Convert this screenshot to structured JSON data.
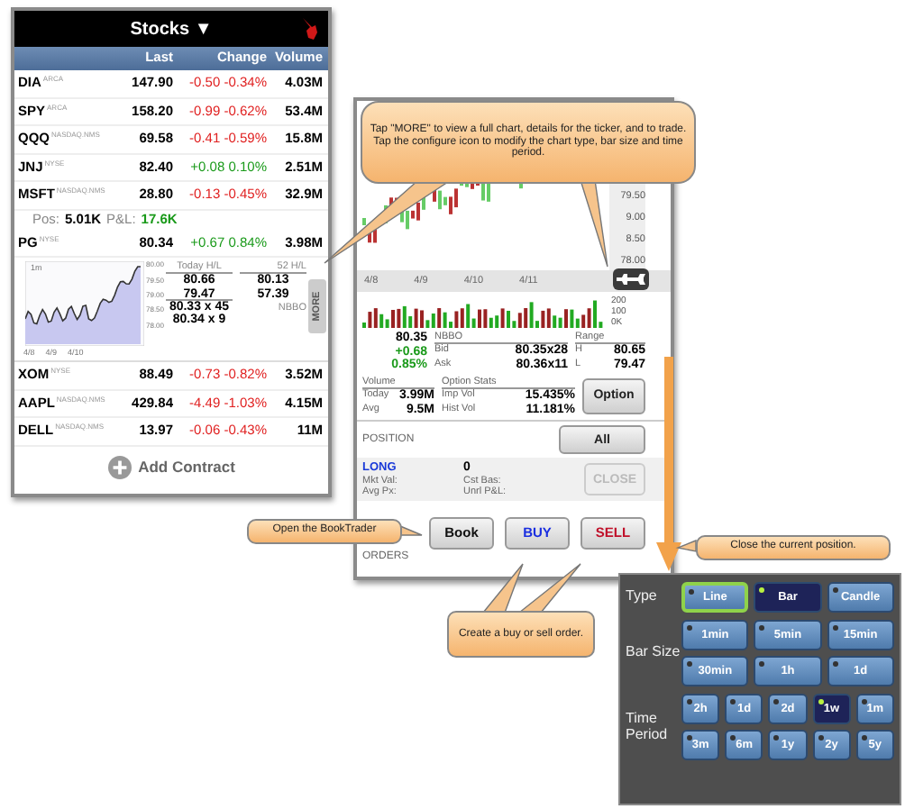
{
  "watchlist": {
    "title": "Stocks",
    "dropdown": "▼",
    "columns": [
      "Last",
      "Change",
      "Volume"
    ],
    "rows": [
      {
        "symbol": "DIA",
        "exchange": "ARCA",
        "last": "147.90",
        "change": "-0.50",
        "change_pct": "-0.34%",
        "volume": "4.03M",
        "negative": true
      },
      {
        "symbol": "SPY",
        "exchange": "ARCA",
        "last": "158.20",
        "change": "-0.99",
        "change_pct": "-0.62%",
        "volume": "53.4M",
        "negative": true
      },
      {
        "symbol": "QQQ",
        "exchange": "NASDAQ.NMS",
        "last": "69.58",
        "change": "-0.41",
        "change_pct": "-0.59%",
        "volume": "15.8M",
        "negative": true
      },
      {
        "symbol": "JNJ",
        "exchange": "NYSE",
        "last": "82.40",
        "change": "+0.08",
        "change_pct": "0.10%",
        "volume": "2.51M",
        "negative": false
      },
      {
        "symbol": "MSFT",
        "exchange": "NASDAQ.NMS",
        "last": "28.80",
        "change": "-0.13",
        "change_pct": "-0.45%",
        "volume": "32.9M",
        "negative": true,
        "position": {
          "pos_label": "Pos:",
          "pos": "5.01K",
          "pnl_label": "P&L:",
          "pnl": "17.6K"
        }
      },
      {
        "symbol": "PG",
        "exchange": "NYSE",
        "last": "80.34",
        "change": "+0.67",
        "change_pct": "0.84%",
        "volume": "3.98M",
        "negative": false,
        "detail": {
          "period": "1m",
          "y_labels": [
            "80.00",
            "79.50",
            "79.00",
            "78.50",
            "78.00"
          ],
          "x_labels": [
            "4/8",
            "4/9",
            "4/10"
          ],
          "today_label": "Today H/L",
          "today_high": "80.66",
          "today_low": "79.47",
          "year_label": "52 H/L",
          "year_high": "80.13",
          "year_low": "57.39",
          "nbbo_label": "NBBO",
          "bid": "80.33 x 45",
          "ask": "80.34 x 9",
          "more": "MORE"
        }
      },
      {
        "symbol": "XOM",
        "exchange": "NYSE",
        "last": "88.49",
        "change": "-0.73",
        "change_pct": "-0.82%",
        "volume": "3.52M",
        "negative": true
      },
      {
        "symbol": "AAPL",
        "exchange": "NASDAQ.NMS",
        "last": "429.84",
        "change": "-4.49",
        "change_pct": "-1.03%",
        "volume": "4.15M",
        "negative": true
      },
      {
        "symbol": "DELL",
        "exchange": "NASDAQ.NMS",
        "last": "13.97",
        "change": "-0.06",
        "change_pct": "-0.43%",
        "volume": "11M",
        "negative": true
      }
    ],
    "add_contract": "Add Contract"
  },
  "details": {
    "chart": {
      "y_labels": [
        "79.50",
        "9.00",
        "8.50",
        "78.00"
      ],
      "x_labels": [
        "4/8",
        "4/9",
        "4/10",
        "4/11"
      ],
      "volume_labels": [
        "200",
        "100",
        "0K"
      ]
    },
    "quote": {
      "last": "80.35",
      "change": "+0.68",
      "change_pct": "0.85%",
      "nbbo_label": "NBBO",
      "bid_label": "Bid",
      "bid": "80.35x28",
      "ask_label": "Ask",
      "ask": "80.36x11",
      "range_label": "Range",
      "high_label": "H",
      "high": "80.65",
      "low_label": "L",
      "low": "79.47"
    },
    "volume": {
      "label": "Volume",
      "today_label": "Today",
      "today": "3.99M",
      "avg_label": "Avg",
      "avg": "9.5M"
    },
    "option_stats": {
      "label": "Option Stats",
      "imp_label": "Imp Vol",
      "imp": "15.435%",
      "hist_label": "Hist Vol",
      "hist": "11.181%",
      "button": "Option"
    },
    "position": {
      "label": "POSITION",
      "filter": "All",
      "side": "LONG",
      "quantity": "0",
      "mkt_val": "Mkt Val:",
      "cost_basis": "Cst Bas:",
      "avg_px": "Avg Px:",
      "unrl_pnl": "Unrl P&L:",
      "close": "CLOSE",
      "close_disabled": true
    },
    "buttons": [
      {
        "label": "Book",
        "kind": "book"
      },
      {
        "label": "BUY",
        "kind": "buy"
      },
      {
        "label": "SELL",
        "kind": "sell"
      }
    ],
    "orders": "ORDERS"
  },
  "chart_config": {
    "groups": [
      {
        "label": "Type",
        "kind": "type",
        "options": [
          {
            "label": "Line",
            "selected": false,
            "focused": true
          },
          {
            "label": "Bar",
            "selected": true,
            "focused": false
          },
          {
            "label": "Candle",
            "selected": false,
            "focused": false
          }
        ]
      },
      {
        "label": "Bar Size",
        "kind": "bar_size",
        "options": [
          {
            "label": "1min",
            "selected": false,
            "focused": false
          },
          {
            "label": "5min",
            "selected": false,
            "focused": false
          },
          {
            "label": "15min",
            "selected": false,
            "focused": false
          },
          {
            "label": "30min",
            "selected": false,
            "focused": false
          },
          {
            "label": "1h",
            "selected": false,
            "focused": false
          },
          {
            "label": "1d",
            "selected": false,
            "focused": false
          }
        ]
      },
      {
        "label": "Time Period",
        "kind": "period",
        "options": [
          {
            "label": "2h",
            "selected": false,
            "focused": false
          },
          {
            "label": "1d",
            "selected": false,
            "focused": false
          },
          {
            "label": "2d",
            "selected": false,
            "focused": false
          },
          {
            "label": "1w",
            "selected": true,
            "focused": false
          },
          {
            "label": "1m",
            "selected": false,
            "focused": false
          },
          {
            "label": "3m",
            "selected": false,
            "focused": false
          },
          {
            "label": "6m",
            "selected": false,
            "focused": false
          },
          {
            "label": "1y",
            "selected": false,
            "focused": false
          },
          {
            "label": "2y",
            "selected": false,
            "focused": false
          },
          {
            "label": "5y",
            "selected": false,
            "focused": false
          }
        ]
      }
    ]
  },
  "callouts": [
    {
      "kind": "more",
      "lines": [
        "Tap \"MORE\" to view a full chart, details for the ticker, and to trade.",
        "Tap the configure icon to modify the chart type, bar size and time period."
      ]
    },
    {
      "kind": "book",
      "lines": [
        "Open the BookTrader"
      ]
    },
    {
      "kind": "close",
      "lines": [
        "Close the current position."
      ]
    },
    {
      "kind": "trade",
      "lines": [
        "Create a buy or sell order."
      ]
    }
  ]
}
